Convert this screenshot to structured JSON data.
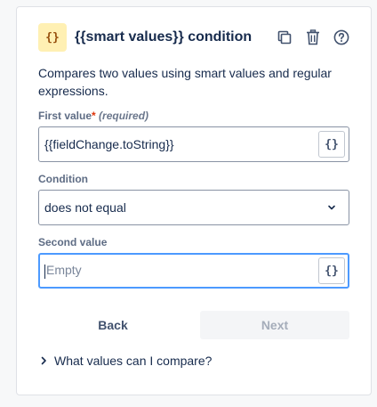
{
  "panel": {
    "badge_text": "{}",
    "title": "{{smart values}} condition",
    "actions": {
      "duplicate_icon": "copy-icon",
      "delete_icon": "trash-icon",
      "help_icon": "help-icon"
    },
    "description": "Compares two values using smart values and regular expressions."
  },
  "first_value": {
    "label": "First value",
    "required_star": "*",
    "required_text": "(required)",
    "value": "{{fieldChange.toString}}",
    "smart_value_button": "{}"
  },
  "condition": {
    "label": "Condition",
    "selected": "does not equal"
  },
  "second_value": {
    "label": "Second value",
    "placeholder": "Empty",
    "smart_value_button": "{}"
  },
  "buttons": {
    "back": "Back",
    "next": "Next"
  },
  "help_expander": {
    "label": "What values can I compare?"
  },
  "colors": {
    "badge_bg": "#fff0b3",
    "badge_fg": "#974f0c",
    "focus_border": "#4c9aff",
    "required": "#de350b",
    "disabled_bg": "#f4f5f7",
    "disabled_fg": "#a5adba"
  }
}
